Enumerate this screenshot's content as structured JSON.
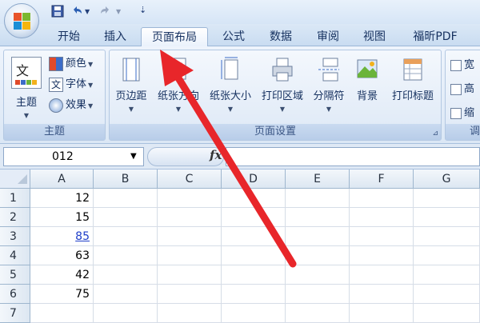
{
  "quick_access": {
    "save_icon": "save-icon",
    "undo_icon": "undo-icon",
    "redo_icon": "redo-icon",
    "customize_icon": "customize-toolbar-icon"
  },
  "tabs": [
    {
      "label": "开始"
    },
    {
      "label": "插入"
    },
    {
      "label": "页面布局"
    },
    {
      "label": "公式"
    },
    {
      "label": "数据"
    },
    {
      "label": "审阅"
    },
    {
      "label": "视图"
    },
    {
      "label": "福昕PDF"
    }
  ],
  "ribbon": {
    "themes_group": {
      "label": "主题",
      "themes_button": "主题",
      "colors_button": "颜色",
      "fonts_button": "字体",
      "effects_button": "效果"
    },
    "page_setup_group": {
      "label": "页面设置",
      "margins": "页边距",
      "orientation": "纸张方向",
      "size": "纸张大小",
      "print_area": "打印区域",
      "breaks": "分隔符",
      "background": "背景",
      "print_titles": "打印标题"
    },
    "scale_group": {
      "label": "调",
      "width": "宽",
      "height": "高",
      "scale": "缩"
    }
  },
  "formula_bar": {
    "name_box": "012",
    "fx_label": "fx",
    "formula": ""
  },
  "sheet": {
    "columns": [
      "A",
      "B",
      "C",
      "D",
      "E",
      "F",
      "G"
    ],
    "rows": [
      "1",
      "2",
      "3",
      "4",
      "5",
      "6",
      "7"
    ],
    "column_a_values": [
      "12",
      "15",
      "85",
      "63",
      "42",
      "75",
      ""
    ]
  },
  "colors": {
    "arrow": "#e8262a",
    "link": "#1f3ec9",
    "ribbon_bg": "#dbe7f5"
  }
}
